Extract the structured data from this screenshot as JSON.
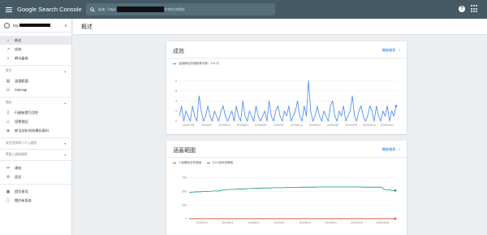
{
  "appbar": {
    "logo_text": "Google Search Console",
    "search_prefix": "檢查「https",
    "search_suffix": "中的任何網址",
    "help_glyph": "?"
  },
  "sidebar": {
    "property_prefix": "http",
    "items": [
      {
        "label": "概述",
        "icon": "home-icon",
        "active": true
      },
      {
        "label": "成效",
        "icon": "trending-icon"
      },
      {
        "label": "網址審查",
        "icon": "search-icon"
      }
    ],
    "sections": [
      {
        "title": "索引",
        "items": [
          {
            "label": "涵蓋範圍",
            "icon": "coverage-icon"
          },
          {
            "label": "Sitemap",
            "icon": "sitemap-icon"
          }
        ]
      },
      {
        "title": "強化",
        "items": [
          {
            "label": "行動裝置可用性",
            "icon": "phone-icon"
          },
          {
            "label": "導覽標記",
            "icon": "breadcrumb-icon"
          },
          {
            "label": "無法剖析的結構化資料",
            "icon": "structured-data-icon"
          }
        ]
      },
      {
        "title": "安全性與專人介入處理",
        "items": []
      },
      {
        "title": "舊版工具和報表",
        "items": []
      }
    ],
    "bottom_items": [
      {
        "label": "連結",
        "icon": "links-icon"
      },
      {
        "label": "設定",
        "icon": "settings-icon"
      }
    ],
    "footer_items": [
      {
        "label": "提交意見",
        "icon": "feedback-icon"
      },
      {
        "label": "關於新版本",
        "icon": "info-icon"
      }
    ]
  },
  "page": {
    "title": "概述"
  },
  "performance": {
    "title": "成效",
    "open_report": "開啟報表",
    "legend": "這個網站的總點擊次數：114 次",
    "colors": {
      "series": "#4285f4"
    },
    "chart_data": {
      "type": "line",
      "x_tick_labels": [
        "2019/7/28",
        "2019/8/5",
        "2019/8/13",
        "2019/8/21",
        "2019/8/29",
        "2019/9/6",
        "2019/9/14",
        "2019/9/22",
        "2019/9/30",
        "2019/10/8",
        "2019/10/16",
        "2019/10/24"
      ],
      "y_ticks": [
        0,
        2,
        4,
        6,
        8
      ],
      "ylim": [
        0,
        9
      ],
      "series": [
        {
          "name": "點擊次數",
          "values": [
            1,
            3,
            0,
            2,
            1,
            0,
            3,
            1,
            0,
            5,
            2,
            0,
            1,
            3,
            1,
            0,
            2,
            1,
            0,
            2,
            3,
            1,
            0,
            1,
            2,
            0,
            3,
            1,
            0,
            4,
            1,
            0,
            2,
            1,
            0,
            3,
            1,
            0,
            1,
            2,
            0,
            4,
            1,
            0,
            2,
            3,
            1,
            0,
            2,
            1,
            3,
            0,
            1,
            2,
            4,
            1,
            0,
            3,
            1,
            8,
            2,
            0,
            1,
            3,
            1,
            0,
            2,
            1,
            0,
            3,
            4,
            1,
            0,
            2,
            1,
            3,
            0,
            1,
            2,
            5,
            1,
            0,
            2,
            3,
            1,
            0,
            1,
            3,
            2,
            0,
            3,
            1,
            0,
            2,
            1,
            3,
            0,
            2,
            1,
            3
          ]
        }
      ]
    }
  },
  "coverage": {
    "title": "涵蓋範圍",
    "open_report": "開啟報表",
    "legend": [
      {
        "label": "1 個網頁含有錯誤",
        "color": "#db4437"
      },
      {
        "label": "514 個有效網頁",
        "color": "#0f9d58"
      }
    ],
    "chart_data": {
      "type": "line",
      "x_tick_labels": [
        "2019/7/31",
        "2019/8/11",
        "2019/8/22",
        "2019/9/2",
        "2019/9/13",
        "2019/9/24",
        "2019/10/5",
        "2019/10/16"
      ],
      "y_ticks": [
        0,
        250,
        500,
        750
      ],
      "ylim": [
        0,
        800
      ],
      "series": [
        {
          "name": "有效",
          "values": [
            480,
            485,
            490,
            490,
            495,
            495,
            500,
            505,
            505,
            510,
            530,
            530,
            535,
            535,
            540,
            540,
            545,
            550,
            550,
            555,
            555,
            560,
            560,
            560,
            565,
            565,
            565,
            565,
            570,
            570,
            570,
            570,
            575,
            575,
            575,
            575,
            575,
            580,
            580,
            580,
            580,
            580,
            580,
            580,
            580,
            580,
            580,
            580,
            580,
            580,
            575,
            575,
            575,
            575,
            575,
            575,
            530,
            530,
            515,
            514
          ]
        },
        {
          "name": "錯誤",
          "values": [
            1,
            1,
            1,
            1,
            1,
            1,
            1,
            1,
            1,
            1,
            1,
            1,
            1,
            1,
            1,
            1,
            1,
            1,
            1,
            1,
            1,
            1,
            1,
            1,
            1,
            1,
            1,
            1,
            1,
            1,
            1,
            1,
            1,
            1,
            1,
            1,
            1,
            1,
            1,
            1,
            1,
            1,
            1,
            1,
            1,
            1,
            1,
            1,
            1,
            1,
            1,
            1,
            1,
            1,
            1,
            1,
            1,
            1,
            1,
            1
          ]
        }
      ]
    }
  }
}
